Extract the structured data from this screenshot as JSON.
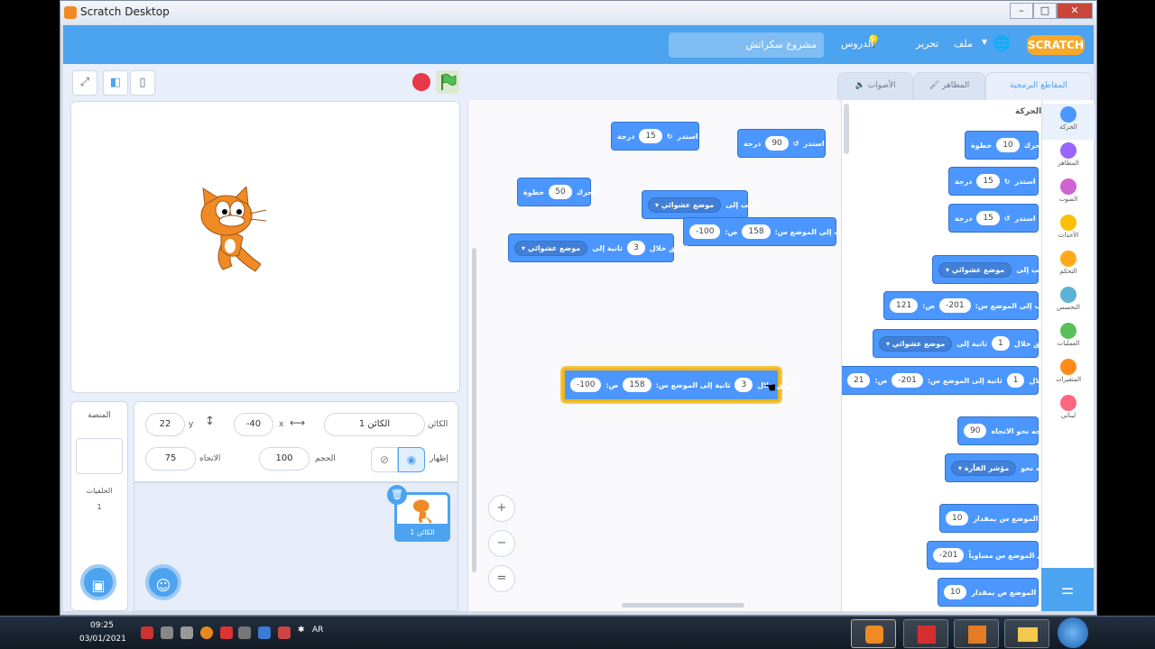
{
  "window": {
    "title": "Scratch Desktop",
    "controls": [
      "–",
      "□",
      "✕"
    ]
  },
  "menubar": {
    "logo": "SCRATCH",
    "language_icon": "globe-icon",
    "file": "ملف",
    "edit": "تحرير",
    "tutorials": "الدروس",
    "project_title": "مشروع سكراتش"
  },
  "tabs": {
    "code": "المقاطع البرمجية",
    "costumes": "المظاهر",
    "sounds": "الأصوات"
  },
  "sprite": {
    "label_sprite": "الكائن",
    "name": "الكائن 1",
    "label_x": "x",
    "x": "-40",
    "label_y": "y",
    "y": "22",
    "label_show": "إظهار",
    "label_size": "الحجم",
    "size": "100",
    "label_direction": "الاتجاه",
    "direction": "75",
    "thumb_label": "الكائن 1"
  },
  "stage_panel": {
    "title": "المنصة",
    "backdrops_label": "الخلفيات",
    "backdrops_count": "1"
  },
  "categories": [
    {
      "label": "الحركة",
      "color": "#4c97ff"
    },
    {
      "label": "المظاهر",
      "color": "#9966ff"
    },
    {
      "label": "الصوت",
      "color": "#cf63cf"
    },
    {
      "label": "الأحداث",
      "color": "#ffbf00"
    },
    {
      "label": "التحكم",
      "color": "#ffab19"
    },
    {
      "label": "التحسس",
      "color": "#5cb1d6"
    },
    {
      "label": "العمليات",
      "color": "#59c059"
    },
    {
      "label": "المتغيرات",
      "color": "#ff8c1a"
    },
    {
      "label": "لبناتي",
      "color": "#ff6680"
    }
  ],
  "palette": {
    "heading": "الحركة",
    "b1": {
      "pre": "تحرك",
      "val": "10",
      "post": "خطوة"
    },
    "b2": {
      "pre": "استدر",
      "val": "15",
      "post": "درجة"
    },
    "b3": {
      "pre": "استدر",
      "val": "15",
      "post": "درجة"
    },
    "b4": {
      "pre": "اذهب إلى",
      "dd": "موضع عشوائي"
    },
    "b5": {
      "pre": "اذهب إلى الموضع س:",
      "v1": "-201",
      "mid": "ص:",
      "v2": "121"
    },
    "b6": {
      "pre": "انزلق خلال",
      "val": "1",
      "mid": "ثانية إلى",
      "dd": "موضع عشوائي"
    },
    "b7": {
      "pre": "انزلق خلال",
      "val": "1",
      "mid": "ثانية إلى الموضع س:",
      "v1": "-201",
      "mid2": "ص:",
      "v2": "21"
    },
    "b8": {
      "pre": "اتجه نحو الاتجاه",
      "val": "90"
    },
    "b9": {
      "pre": "اتجه نحو",
      "dd": "مؤشر الفأرة"
    },
    "b10": {
      "pre": "غيِّر الموضع س بمقدار",
      "val": "10"
    },
    "b11": {
      "pre": "اجعل الموضع س مساوياً",
      "val": "-201"
    },
    "b12": {
      "pre": "غيِّر الموضع ص بمقدار",
      "val": "10"
    }
  },
  "script": {
    "s1": {
      "pre": "استدر",
      "val": "15",
      "post": "درجة"
    },
    "s2": {
      "pre": "استدر",
      "val": "90",
      "post": "درجة"
    },
    "s3": {
      "pre": "تحرك",
      "val": "50",
      "post": "خطوة"
    },
    "s4": {
      "pre": "اذهب إلى",
      "dd": "موضع عشوائي"
    },
    "s5": {
      "pre": "اذهب إلى الموضع س:",
      "v1": "158",
      "mid": "ص:",
      "v2": "-100"
    },
    "s6": {
      "pre": "انزلق خلال",
      "val": "3",
      "mid": "ثانية إلى",
      "dd": "موضع عشوائي"
    },
    "s7": {
      "pre": "انزلق خلال",
      "val": "3",
      "mid": "ثانية إلى الموضع س:",
      "v1": "158",
      "mid2": "ص:",
      "v2": "-100"
    }
  },
  "taskbar": {
    "time": "09:25",
    "date": "03/01/2021",
    "lang": "AR"
  }
}
